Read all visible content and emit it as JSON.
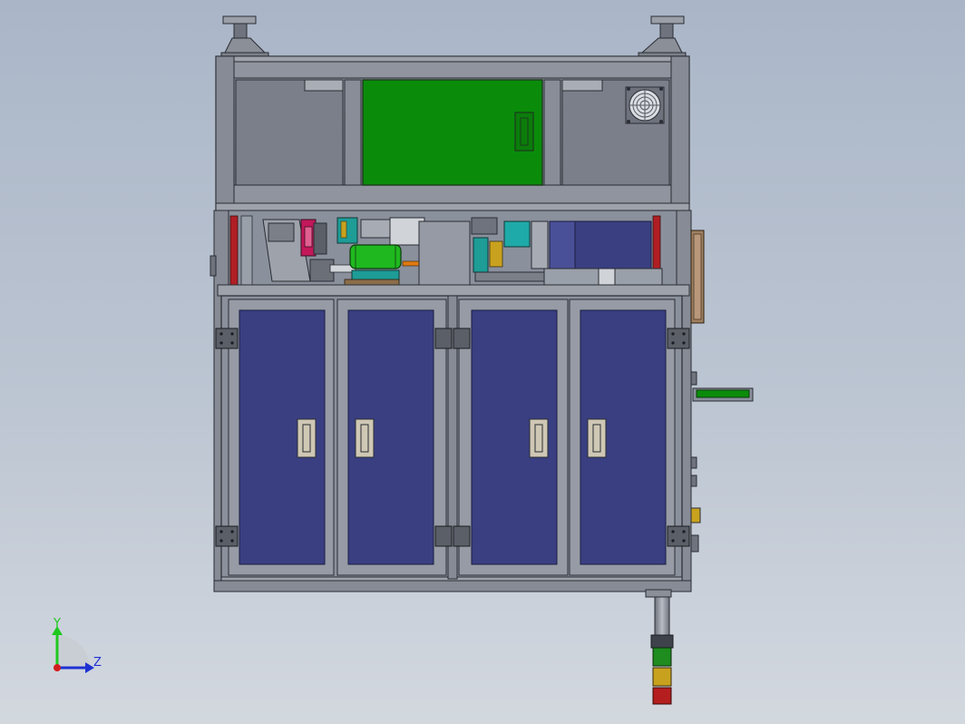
{
  "view": {
    "background_top": "#aab6c8",
    "background_bottom": "#d3d8df"
  },
  "machine": {
    "frame_color": "#8a909c",
    "panel_grey": "#7c818d",
    "control_panel_color": "#0a8c0a",
    "door_panel_color": "#3a3f82",
    "door_count": 4,
    "hmi_arm_color": "#0a8c0a",
    "signal_tower": [
      "#1e8c1e",
      "#c8a21e",
      "#b41e1e"
    ]
  },
  "triad": {
    "y_label": "Y",
    "z_label": "Z",
    "y_color": "#1ec81e",
    "z_color": "#1e32d2",
    "origin_color": "#d21e1e"
  }
}
